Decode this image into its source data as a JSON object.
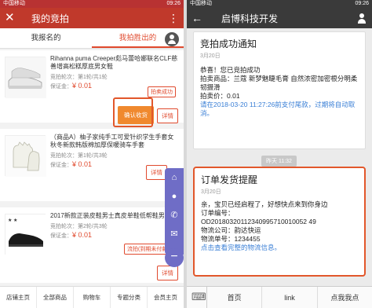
{
  "left": {
    "status_left": "中国移动",
    "status_time": "09:26",
    "header_title": "我的竞拍",
    "tabs": [
      "我报名的",
      "我拍胜出的"
    ],
    "items": [
      {
        "name": "Rihanna puma Creeper彪马蕾哈娜联名CLF慈善增高松糕厚底男女鞋",
        "rounds": "竞拍轮次：第1轮/共1轮",
        "deposit_label": "保证金：",
        "deposit": "¥ 0.01",
        "badge": "拍卖成功",
        "confirm": "确认收货",
        "detail": "详情"
      },
      {
        "name": "（商品A）柚子家纯手工可爱针织学生手套女秋冬新款韩版棉加厚保暖骑车手套",
        "rounds": "竞拍轮次：第1轮/共3轮",
        "deposit_label": "保证金：",
        "deposit": "¥ 0.01",
        "detail": "详情"
      },
      {
        "name": "2017新款正装皮鞋男士真皮单鞋低帮鞋男鞋",
        "rounds": "竞拍轮次：第2轮/共3轮",
        "deposit_label": "保证金：",
        "deposit": "¥ 0.01",
        "badge": "流拍(到期未付款)",
        "detail": "详情"
      }
    ],
    "bottom_nav": [
      "店铺主页",
      "全部商品",
      "购物车",
      "专题分类",
      "会员主页"
    ]
  },
  "right": {
    "status_left": "中国移动",
    "status_time": "09:26",
    "header_title": "启博科技开发",
    "card1": {
      "title": "竞拍成功通知",
      "date": "3月20日",
      "line1": "恭喜！您已竞拍成功",
      "line2": "拍卖商品：兰蔻 新梦魅睫毛膏 自然浓密加密根分明柔韧摄滑",
      "line3": "拍卖价：0.01",
      "line4": "请在2018-03-20 11:27:26前支付尾款，过期将自动取消。"
    },
    "time_chip": "昨天 11:32",
    "card2": {
      "title": "订单发货提醒",
      "date": "3月20日",
      "line1": "亲，宝贝已经启程了，好想快点来到你身边",
      "line2": "订单编号：",
      "line3": "OD20180320112340995710010052 49",
      "line4": "物流公司：韵达快运",
      "line5": "物流单号：1234455",
      "line6": "点击查看完整的物流信息。"
    },
    "bottom_nav": [
      "首页",
      "link",
      "点我我点"
    ]
  }
}
